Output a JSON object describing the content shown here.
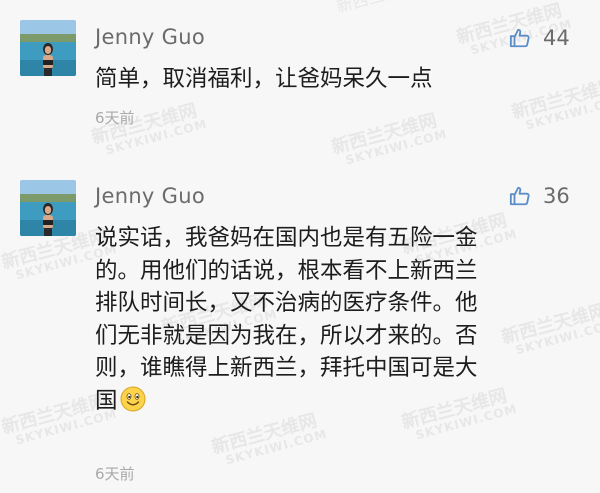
{
  "comments": [
    {
      "author": "Jenny Guo",
      "likes": "44",
      "lines": [
        "简单，取消福利，让爸妈呆久一点"
      ],
      "time": "6天前",
      "like_icon": "thumbs-up-icon",
      "avatar": "avatar-photo"
    },
    {
      "author": "Jenny Guo",
      "likes": "36",
      "lines": [
        "说实话，我爸妈在国内也是有五险一金",
        "的。用他们的话说，根本看不上新西兰",
        "排队时间长，又不治病的医疗条件。他",
        "们无非就是因为我在，所以才来的。否",
        "则，谁瞧得上新西兰，拜托中国可是大",
        "国"
      ],
      "emoji": "smiley-emoji-icon",
      "time": "6天前",
      "like_icon": "thumbs-up-icon",
      "avatar": "avatar-photo"
    }
  ],
  "watermark": {
    "cn": "新西兰天维网",
    "en": "SKYKIWI.COM"
  },
  "colors": {
    "background": "#f7f7f7",
    "author": "#6b6b6b",
    "body": "#1d1d1d",
    "time": "#a9a9a9",
    "like_icon": "#5b8ec6"
  }
}
